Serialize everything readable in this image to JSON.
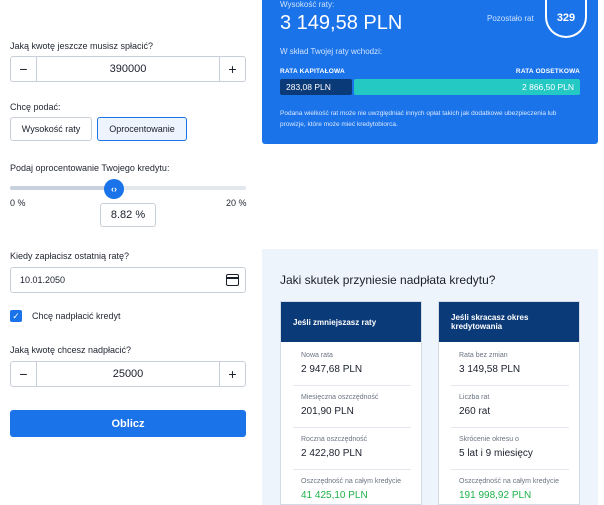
{
  "form": {
    "remaining_label": "Jaką kwotę jeszcze musisz spłacić?",
    "remaining_value": "390000",
    "choose_label": "Chcę podać:",
    "toggle_rate": "Wysokość raty",
    "toggle_interest": "Oprocentowanie",
    "interest_label": "Podaj oprocentowanie Twojego kredytu:",
    "slider_min": "0 %",
    "slider_max": "20 %",
    "slider_value": "8.82 %",
    "slider_fraction": 0.441,
    "last_payment_label": "Kiedy zapłacisz ostatnią ratę?",
    "last_payment_value": "10.01.2050",
    "overpay_checkbox_label": "Chcę nadpłacić kredyt",
    "overpay_amount_label": "Jaką kwotę chcesz nadpłacić?",
    "overpay_amount_value": "25000",
    "submit": "Oblicz"
  },
  "summary": {
    "rate_label": "Wysokość raty:",
    "rate_value": "3 149,58 PLN",
    "remaining_label": "Pozostało rat",
    "remaining_count": "329",
    "breakdown_label": "W skład Twojej raty wchodzi:",
    "capital_head": "RATA KAPITAŁOWA",
    "interest_head": "RATA ODSETKOWA",
    "capital_value": "283,08 PLN",
    "interest_value": "2 866,50 PLN",
    "note": "Podana wielkość rat może nie uwzględniać innych opłat takich jak dodatkowe ubezpieczenia lub prowizje, które może mieć kredytobiorca."
  },
  "overpay": {
    "title": "Jaki skutek przyniesie nadpłata kredytu?",
    "card_left": {
      "head": "Jeśli zmniejszasz raty",
      "rows": [
        {
          "label": "Nowa rata",
          "value": "2 947,68 PLN"
        },
        {
          "label": "Miesięczna oszczędność",
          "value": "201,90 PLN"
        },
        {
          "label": "Roczna oszczędność",
          "value": "2 422,80 PLN"
        },
        {
          "label": "Oszczędność na całym kredycie",
          "value": "41 425,10 PLN"
        }
      ]
    },
    "card_right": {
      "head": "Jeśli skracasz okres kredytowania",
      "rows": [
        {
          "label": "Rata bez zmian",
          "value": "3 149,58 PLN"
        },
        {
          "label": "Liczba rat",
          "value": "260 rat"
        },
        {
          "label": "Skrócenie okresu o",
          "value": "5 lat i 9 miesięcy"
        },
        {
          "label": "Oszczędność na całym kredycie",
          "value": "191 998,92 PLN"
        }
      ]
    }
  },
  "colors": {
    "accent": "#1a73e8",
    "navy": "#0b3a78",
    "teal": "#25c9c3",
    "green": "#1fb24a"
  }
}
